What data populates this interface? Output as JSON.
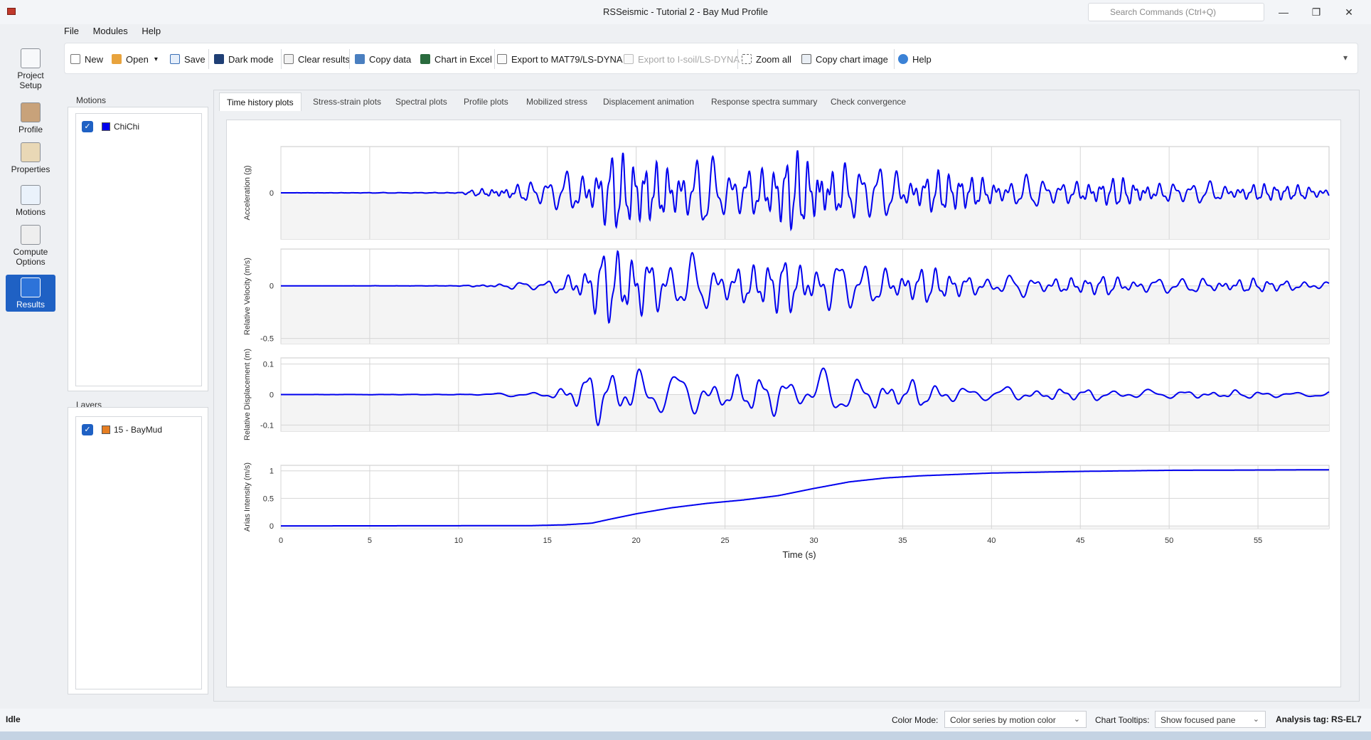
{
  "window": {
    "title": "RSSeismic - Tutorial 2 - Bay Mud Profile",
    "search_placeholder": "Search Commands (Ctrl+Q)",
    "minimize": "—",
    "maximize": "❐",
    "close": "✕"
  },
  "menu": [
    "File",
    "Modules",
    "Help"
  ],
  "toolbar": {
    "new": "New",
    "open": "Open",
    "save": "Save",
    "dark_mode": "Dark mode",
    "clear_results": "Clear results",
    "copy_data": "Copy data",
    "chart_in_excel": "Chart in Excel",
    "export_mat79": "Export to MAT79/LS-DYNA",
    "export_isoil": "Export to I-soil/LS-DYNA",
    "zoom_all": "Zoom all",
    "copy_chart_image": "Copy chart image",
    "help": "Help"
  },
  "sidenav": {
    "project_setup": "Project Setup",
    "profile": "Profile",
    "properties": "Properties",
    "motions": "Motions",
    "compute_options": "Compute Options",
    "results": "Results",
    "active": "Results"
  },
  "motions_panel": {
    "title": "Motions",
    "items": [
      {
        "label": "ChiChi",
        "checked": true,
        "color": "#0000ee"
      }
    ]
  },
  "layers_panel": {
    "title": "Layers",
    "items": [
      {
        "label": "15 - BayMud",
        "checked": true,
        "color": "#e67e22"
      }
    ]
  },
  "tabs": {
    "items": [
      "Time history plots",
      "Stress-strain plots",
      "Spectral plots",
      "Profile plots",
      "Mobilized stress",
      "Displacement animation",
      "Response spectra summary",
      "Check convergence"
    ],
    "active": "Time history plots"
  },
  "chart_data": {
    "type": "line",
    "xlabel": "Time (s)",
    "xlim": [
      0,
      59
    ],
    "x_ticks": [
      0,
      5,
      10,
      15,
      20,
      25,
      30,
      35,
      40,
      45,
      50,
      55
    ],
    "series_color": "#0000ee",
    "panels": [
      {
        "ylabel": "Acceleration (g)",
        "y_ticks": [
          {
            "v": 0,
            "label": "0"
          }
        ],
        "ylim": [
          -0.2,
          0.2
        ],
        "signal": {
          "kind": "oscillation",
          "start": 10,
          "freq": 1.3,
          "envelope": [
            [
              0,
              0
            ],
            [
              10,
              0.002
            ],
            [
              15,
              0.06
            ],
            [
              18,
              0.16
            ],
            [
              22,
              0.15
            ],
            [
              26,
              0.13
            ],
            [
              30,
              0.16
            ],
            [
              34,
              0.11
            ],
            [
              40,
              0.07
            ],
            [
              50,
              0.05
            ],
            [
              59,
              0.03
            ]
          ]
        }
      },
      {
        "ylabel": "Relative Velocity (m/s)",
        "y_ticks": [
          {
            "v": 0,
            "label": "0"
          },
          {
            "v": -0.5,
            "label": "-0.5"
          }
        ],
        "ylim": [
          -0.55,
          0.35
        ],
        "signal": {
          "kind": "oscillation",
          "start": 10,
          "freq": 0.95,
          "envelope": [
            [
              0,
              0
            ],
            [
              10,
              0.002
            ],
            [
              15,
              0.05
            ],
            [
              18,
              0.3
            ],
            [
              20,
              0.4
            ],
            [
              22,
              0.28
            ],
            [
              26,
              0.22
            ],
            [
              30,
              0.28
            ],
            [
              34,
              0.2
            ],
            [
              40,
              0.1
            ],
            [
              50,
              0.08
            ],
            [
              59,
              0.05
            ]
          ]
        }
      },
      {
        "ylabel": "Relative Displacement (m)",
        "y_ticks": [
          {
            "v": 0.1,
            "label": "0.1"
          },
          {
            "v": 0,
            "label": "0"
          },
          {
            "v": -0.1,
            "label": "-0.1"
          }
        ],
        "ylim": [
          -0.12,
          0.12
        ],
        "signal": {
          "kind": "oscillation",
          "start": 10,
          "freq": 0.6,
          "envelope": [
            [
              0,
              0
            ],
            [
              10,
              0.001
            ],
            [
              15,
              0.01
            ],
            [
              18,
              0.09
            ],
            [
              20,
              0.1
            ],
            [
              24,
              0.06
            ],
            [
              29,
              0.07
            ],
            [
              31,
              0.08
            ],
            [
              34,
              0.05
            ],
            [
              40,
              0.025
            ],
            [
              50,
              0.015
            ],
            [
              59,
              0.01
            ]
          ]
        }
      },
      {
        "ylabel": "Arias Intensity (m/s)",
        "y_ticks": [
          {
            "v": 1,
            "label": "1"
          },
          {
            "v": 0.5,
            "label": "0.5"
          },
          {
            "v": 0,
            "label": "0"
          }
        ],
        "ylim": [
          -0.05,
          1.1
        ],
        "signal": {
          "kind": "cumulative",
          "points": [
            [
              0,
              0
            ],
            [
              14,
              0.005
            ],
            [
              16,
              0.02
            ],
            [
              17.5,
              0.05
            ],
            [
              18.5,
              0.12
            ],
            [
              20,
              0.22
            ],
            [
              22,
              0.33
            ],
            [
              24,
              0.41
            ],
            [
              26,
              0.47
            ],
            [
              28,
              0.55
            ],
            [
              30,
              0.68
            ],
            [
              32,
              0.8
            ],
            [
              34,
              0.87
            ],
            [
              36,
              0.91
            ],
            [
              40,
              0.96
            ],
            [
              45,
              0.99
            ],
            [
              50,
              1.01
            ],
            [
              59,
              1.02
            ]
          ]
        }
      }
    ]
  },
  "status": {
    "idle": "Idle",
    "color_mode_label": "Color Mode:",
    "color_mode_value": "Color series by motion color",
    "tooltips_label": "Chart Tooltips:",
    "tooltips_value": "Show focused pane",
    "analysis_tag": "Analysis tag: RS-EL7"
  }
}
